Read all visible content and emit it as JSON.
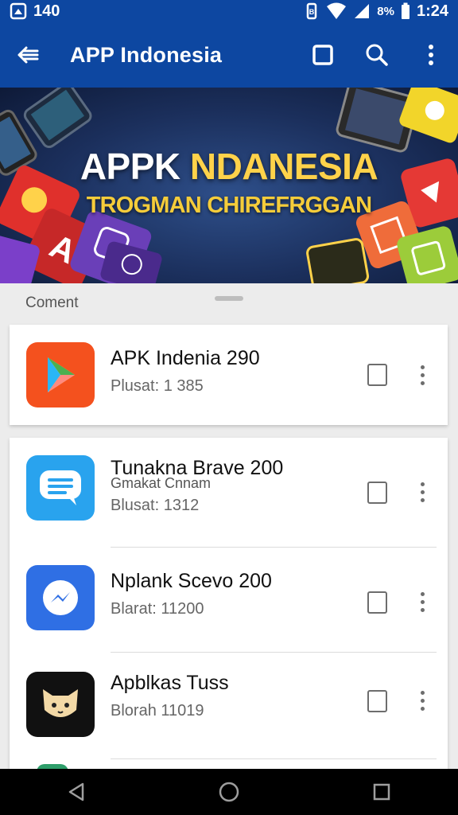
{
  "status_bar": {
    "left_text": "140",
    "time": "1:24",
    "signal_label": "8%"
  },
  "app_bar": {
    "title": "APP Indonesia",
    "background_color": "#0d47a1"
  },
  "banner": {
    "title_part1": "APPK ",
    "title_part2": "NDANESIA",
    "subtitle": "TROGMAN CHIREFRGGAN"
  },
  "section": {
    "label": "Coment"
  },
  "apps": [
    {
      "name": "APK Indenia 290",
      "sub": "",
      "meta": "Plusat: 1 385",
      "icon": "play-store-icon",
      "color": "#f4511e"
    },
    {
      "name": "Tunakna Brave 200",
      "sub": "Gmakat Cnnam",
      "meta": "Blusat: 1312",
      "icon": "chat-bubble-icon",
      "color": "#29a3ee"
    },
    {
      "name": "Nplank Scevo 200",
      "sub": "",
      "meta": "Blarat: 11200",
      "icon": "messenger-icon",
      "color": "#2f6fe4"
    },
    {
      "name": "Apblkas Tuss",
      "sub": "",
      "meta": "Blorah 11019",
      "icon": "cat-face-icon",
      "color": "#111111"
    }
  ]
}
